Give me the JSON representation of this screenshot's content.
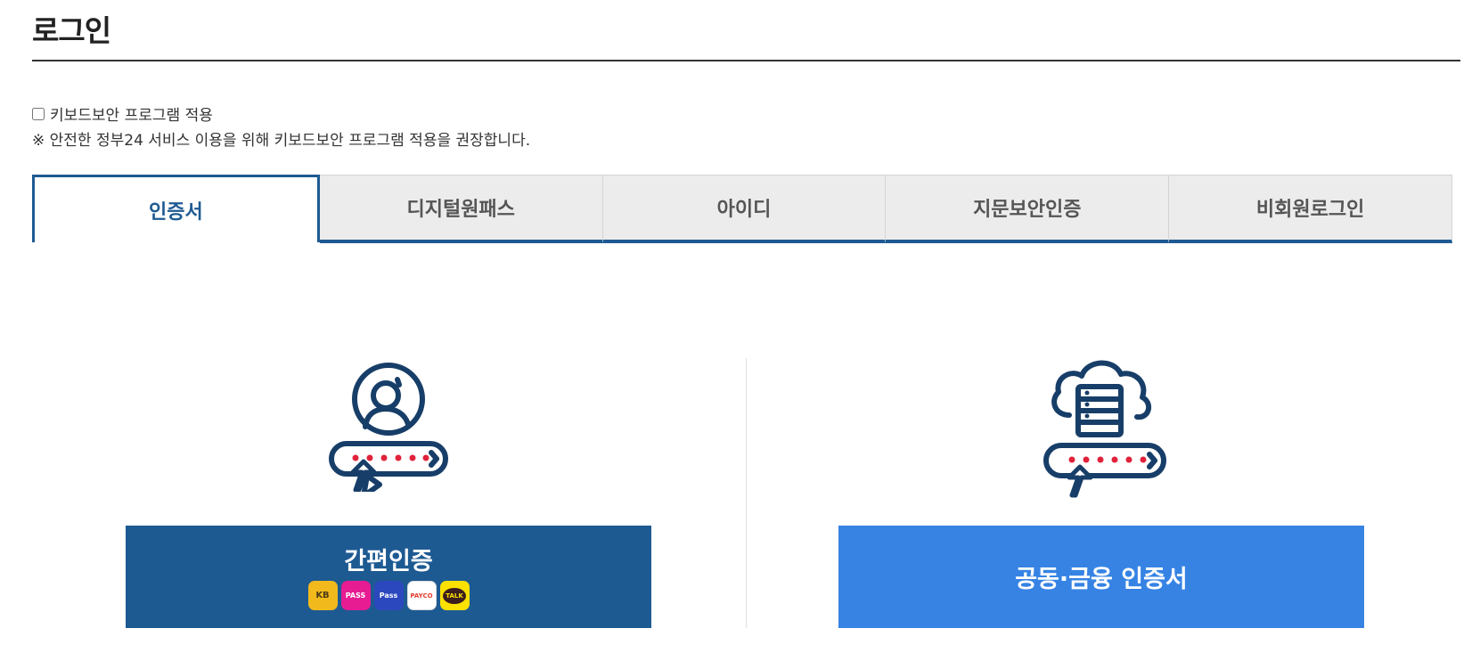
{
  "header": {
    "title": "로그인"
  },
  "keyboard_security": {
    "checkbox_label": "키보드보안 프로그램 적용",
    "note": "※ 안전한 정부24 서비스 이용을 위해 키보드보안 프로그램 적용을 권장합니다.",
    "checked": false
  },
  "tabs": [
    {
      "label": "인증서",
      "active": true
    },
    {
      "label": "디지털원패스",
      "active": false
    },
    {
      "label": "아이디",
      "active": false
    },
    {
      "label": "지문보안인증",
      "active": false
    },
    {
      "label": "비회원로그인",
      "active": false
    }
  ],
  "panels": {
    "simple_auth": {
      "button_label": "간편인증",
      "providers": [
        {
          "name": "kb-icon",
          "text": "KB"
        },
        {
          "name": "pass-icon",
          "text": "PASS"
        },
        {
          "name": "samsung-pass-icon",
          "text": "Pass"
        },
        {
          "name": "payco-icon",
          "text": "PAYCO"
        },
        {
          "name": "kakao-talk-icon",
          "text": "TALK"
        }
      ]
    },
    "joint_cert": {
      "button_label": "공동·금융 인증서"
    }
  },
  "colors": {
    "primary_dark": "#1e5a92",
    "primary_light": "#3683e4",
    "password_dots": "#e0223a"
  }
}
